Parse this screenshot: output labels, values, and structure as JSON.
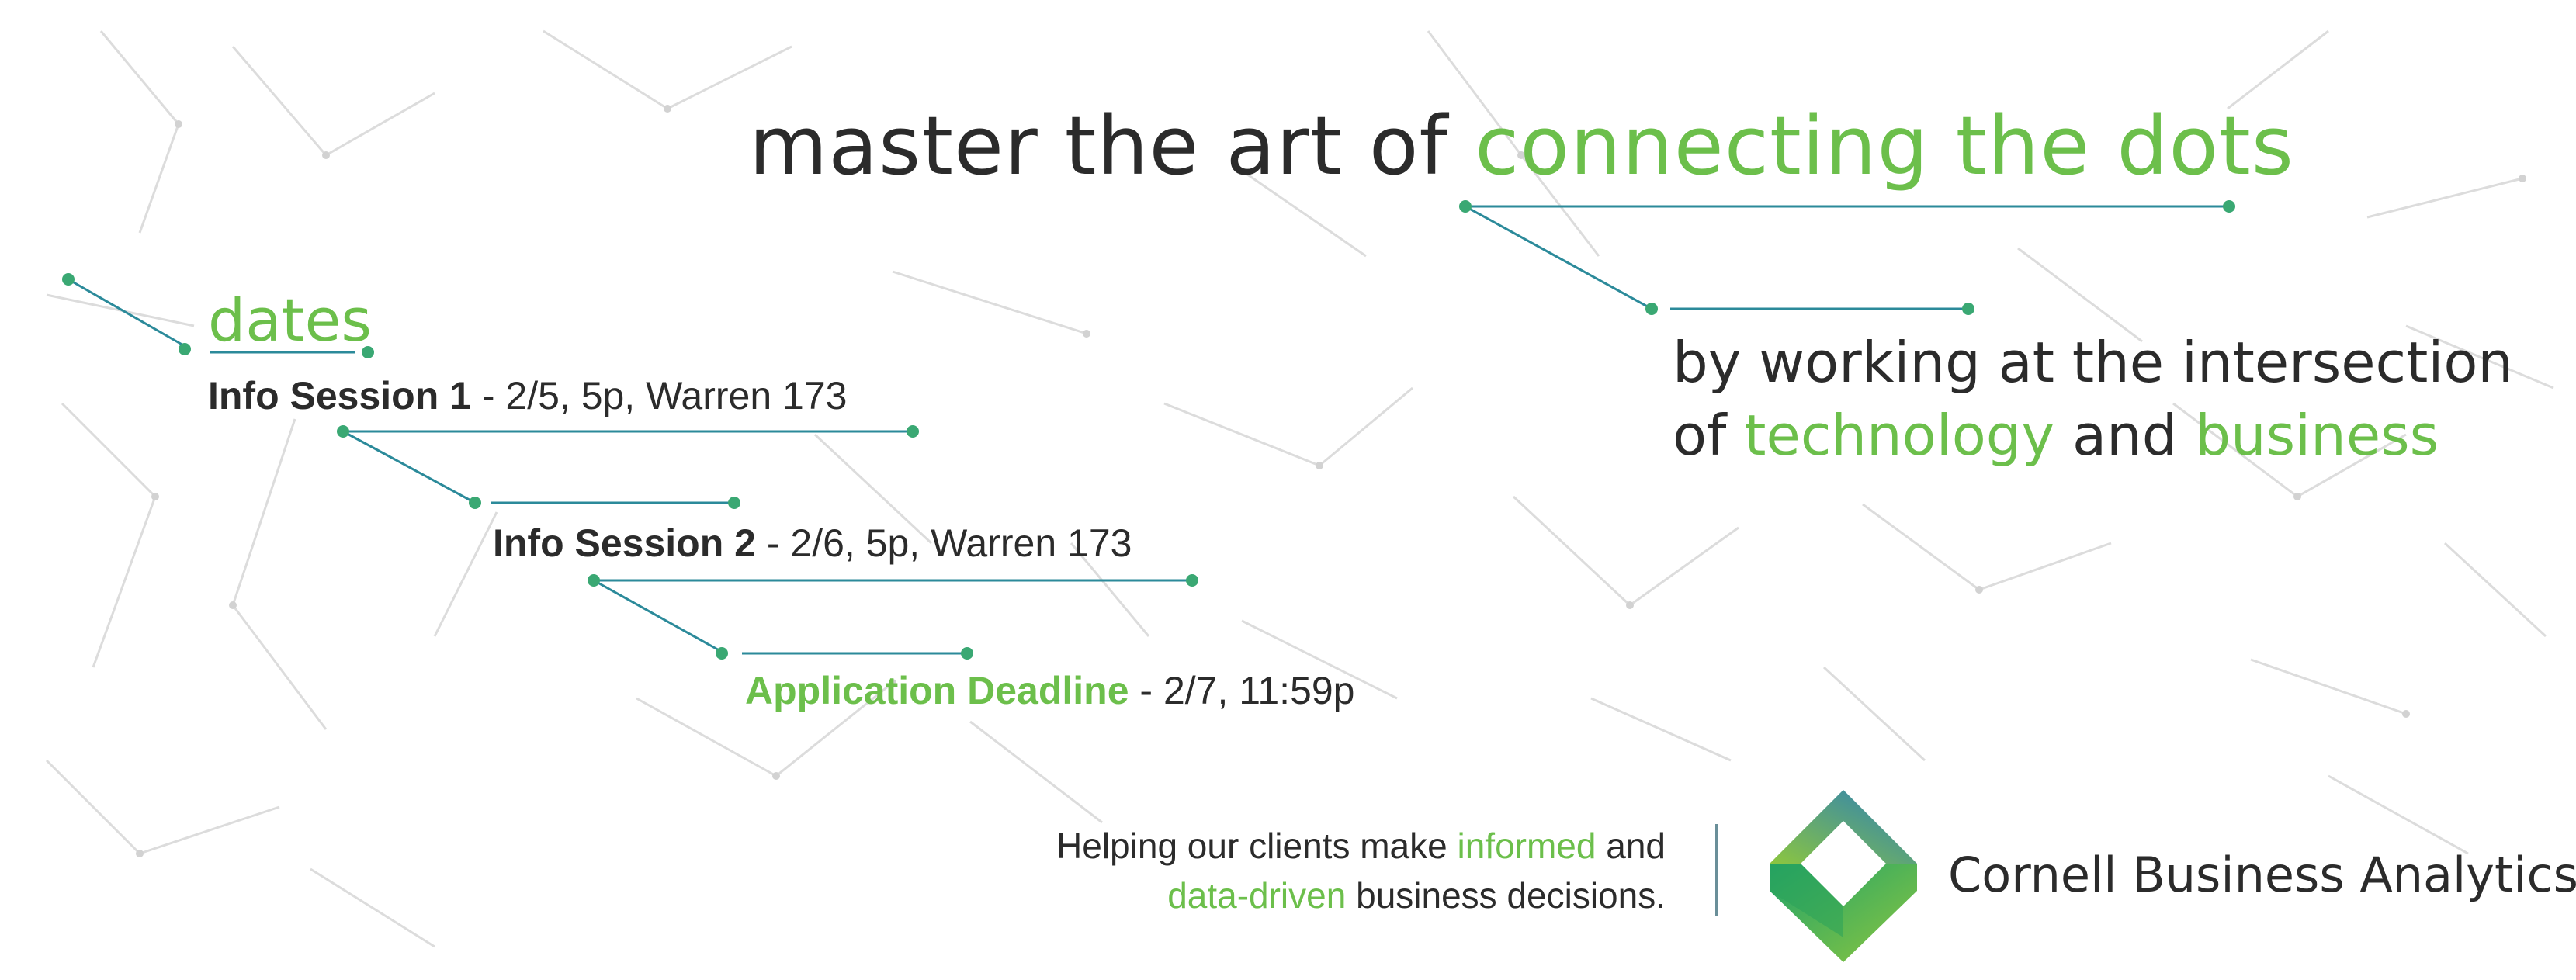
{
  "headline": {
    "prefix": "master the art of ",
    "highlight": "connecting the dots"
  },
  "subheadline": {
    "line1": "by working at the intersection",
    "of_word": "of ",
    "technology": "technology",
    "and_word": " and ",
    "business": "business"
  },
  "dates": {
    "title": "dates",
    "events": [
      {
        "name": "Info Session 1",
        "details": " - 2/5, 5p, Warren 173"
      },
      {
        "name": "Info Session 2",
        "details": " - 2/6, 5p, Warren 173"
      },
      {
        "name": "Application Deadline",
        "details": " - 2/7, 11:59p"
      }
    ]
  },
  "tagline": {
    "part1": "Helping our clients make ",
    "informed": "informed",
    "part2": " and",
    "data_driven": "data-driven",
    "part3": " business decisions."
  },
  "brand": {
    "name": "Cornell Business Analytics"
  },
  "colors": {
    "accent_green": "#6cbf4b",
    "line_teal": "#2b8a9a",
    "dot_green": "#3aa873",
    "text_dark": "#2b2b2b",
    "network_gray": "#d9d9d9"
  },
  "icons": {
    "logo": "diamond-cube-logo"
  }
}
